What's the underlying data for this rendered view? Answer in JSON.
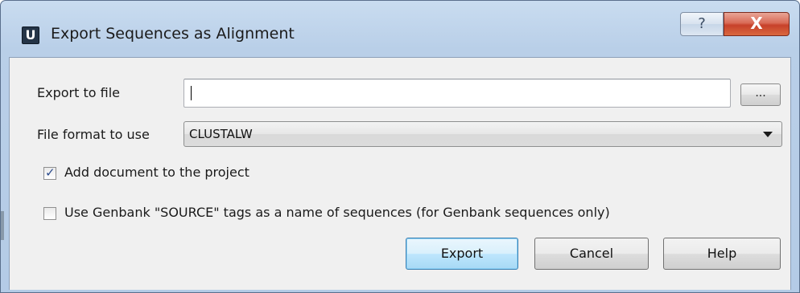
{
  "window": {
    "app_icon_letter": "U",
    "title": "Export Sequences as Alignment",
    "help_button_label": "?",
    "close_button_label": "X"
  },
  "export_to_file": {
    "label": "Export to file",
    "value": "",
    "browse_label": "..."
  },
  "file_format": {
    "label": "File format to use",
    "selected": "CLUSTALW"
  },
  "options": {
    "add_document": {
      "label": "Add document to the project",
      "checked": true
    },
    "use_genbank": {
      "label": "Use Genbank \"SOURCE\" tags as a name of sequences (for Genbank sequences only)",
      "checked": false
    }
  },
  "buttons": {
    "export": "Export",
    "cancel": "Cancel",
    "help": "Help"
  },
  "colors": {
    "title_bar": "#b9cfe8",
    "close_button": "#c7412a",
    "default_button_border": "#3c7fb1",
    "panel_background": "#f0f0f0"
  }
}
